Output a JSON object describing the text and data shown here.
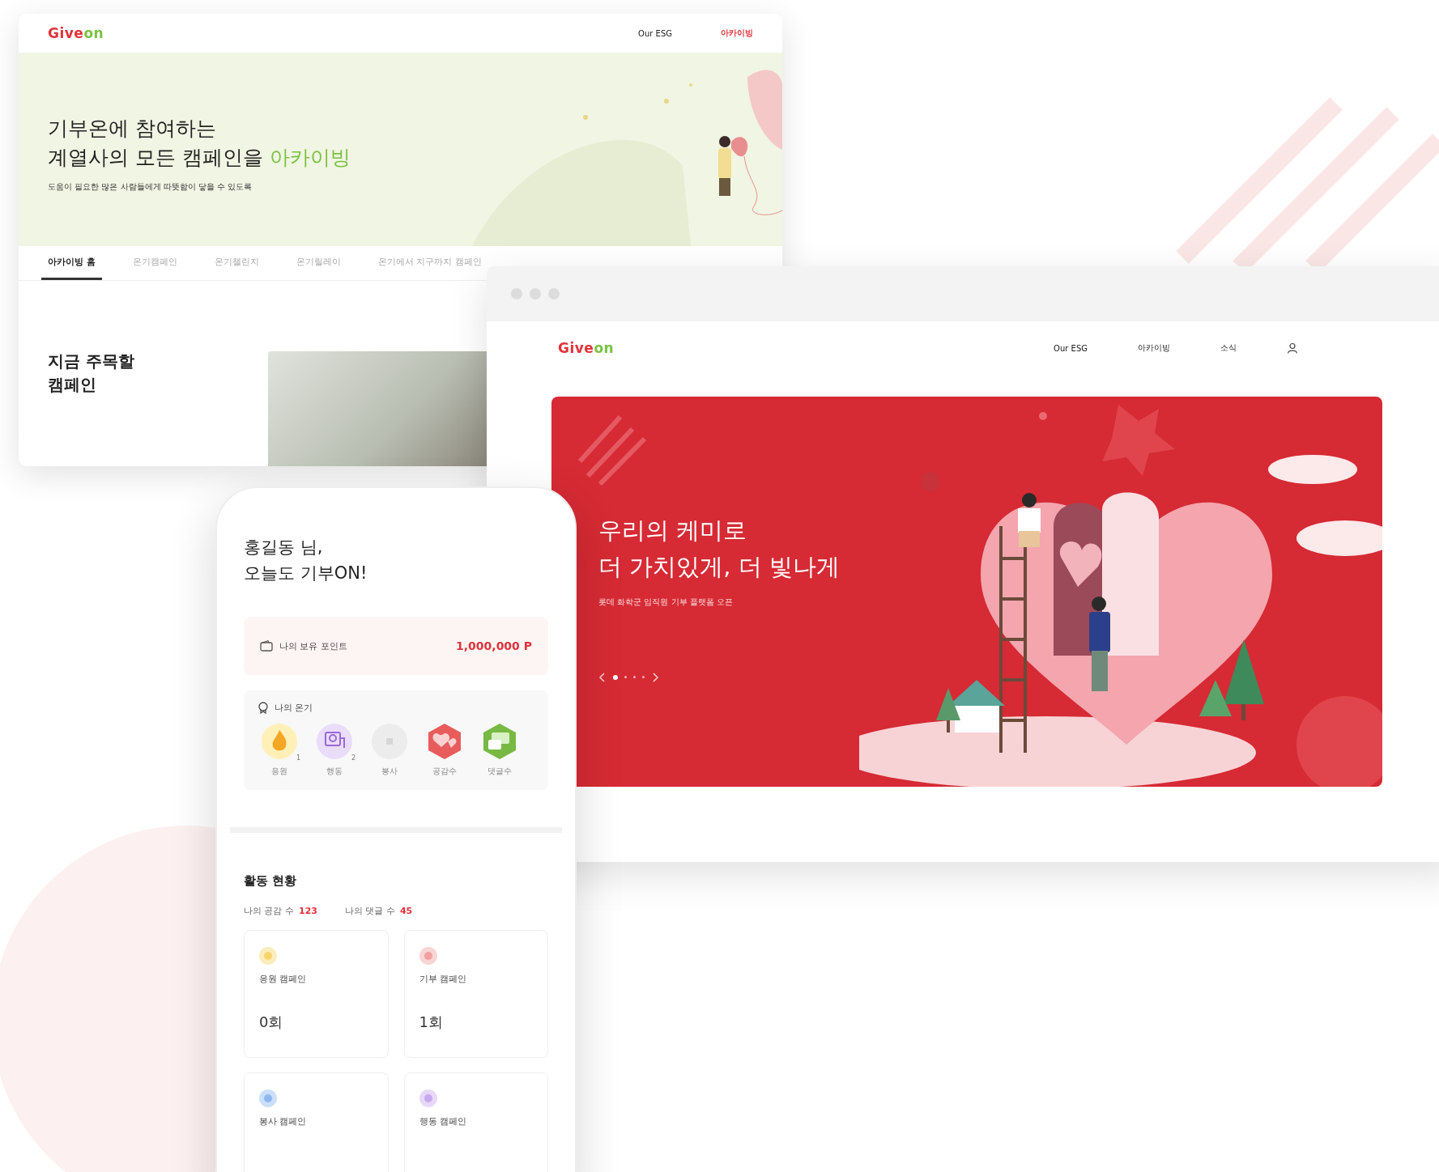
{
  "archive_window": {
    "logo": {
      "first": "Give",
      "second": "on"
    },
    "nav": [
      {
        "label": "Our ESG",
        "selected": false
      },
      {
        "label": "아카이빙",
        "selected": true
      }
    ],
    "hero": {
      "title_line_1": "기부온에 참여하는",
      "title_line_2": "계열사의 모든 캠페인을 ",
      "title_highlight": "아카이빙",
      "subtitle": "도움이 필요한 많은 사람들에게 따뜻함이 닿을 수 있도록"
    },
    "tabs": [
      {
        "label": "아카이빙 홈",
        "selected": true
      },
      {
        "label": "온기캠페인",
        "selected": false
      },
      {
        "label": "온기챌린지",
        "selected": false
      },
      {
        "label": "온기릴레이",
        "selected": false
      },
      {
        "label": "온기에서 지구까지 캠페인",
        "selected": false
      }
    ],
    "section_title": "지금 주목할\n캠페인"
  },
  "main_window": {
    "logo": {
      "first": "Give",
      "second": "on"
    },
    "nav": [
      {
        "label": "Our ESG",
        "selected": false
      },
      {
        "label": "아카이빙",
        "selected": false
      },
      {
        "label": "소식",
        "selected": false
      }
    ],
    "banner": {
      "title": "우리의 케미로\n더 가치있게, 더 빛나게",
      "subtitle": "롯데 화학군 임직원 기부 플랫폼 오픈",
      "slides": [
        {
          "selected": true
        },
        {
          "selected": false
        },
        {
          "selected": false
        },
        {
          "selected": false
        }
      ]
    }
  },
  "phone": {
    "greeting": "홍길동 님,\n오늘도 기부ON!",
    "points": {
      "label": "나의 보유 포인트",
      "value": "1,000,000 P"
    },
    "warmth": {
      "title": "나의 온기",
      "badges": [
        {
          "kind": "fire",
          "label": "응원",
          "count": "1",
          "earned": true
        },
        {
          "kind": "idea",
          "label": "행동",
          "count": "2",
          "earned": true
        },
        {
          "kind": "volunteer",
          "label": "봉사",
          "earned": false
        },
        {
          "kind": "heart",
          "label": "공감수",
          "earned": true
        },
        {
          "kind": "chat",
          "label": "댓글수",
          "earned": true
        }
      ]
    },
    "activity": {
      "title": "활동 현황",
      "stats": [
        {
          "label": "나의 공감 수",
          "value": "123"
        },
        {
          "label": "나의 댓글 수",
          "value": "45"
        }
      ],
      "cards": [
        {
          "kind": "cheer",
          "title": "응원 캠페인",
          "count": "0회"
        },
        {
          "kind": "donate",
          "title": "기부 캠페인",
          "count": "1회"
        },
        {
          "kind": "volunteer",
          "title": "봉사 캠페인"
        },
        {
          "kind": "action",
          "title": "행동 캠페인"
        }
      ]
    }
  }
}
